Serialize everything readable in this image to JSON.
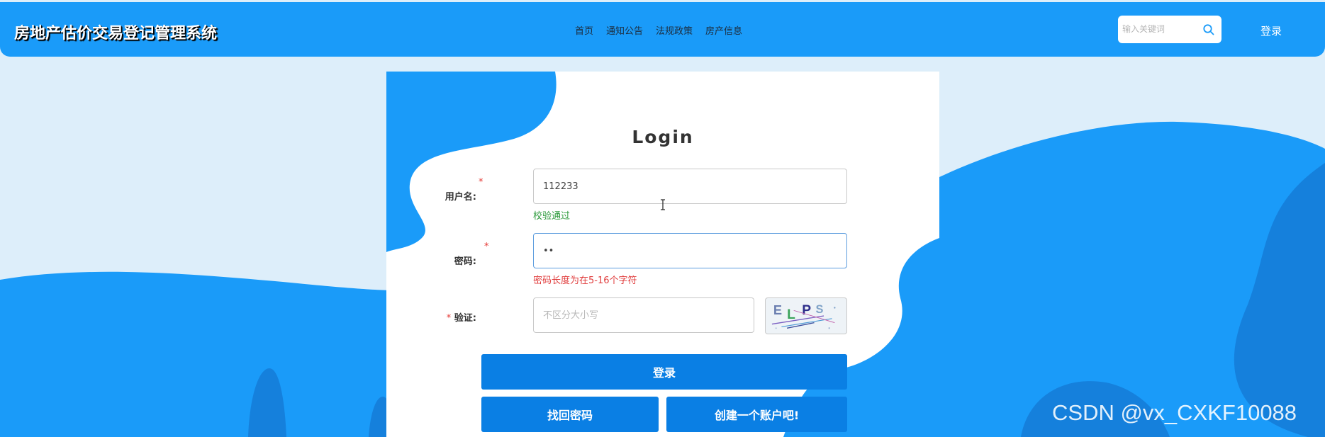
{
  "header": {
    "site_title": "房地产估价交易登记管理系统",
    "nav": [
      "首页",
      "通知公告",
      "法规政策",
      "房产信息"
    ],
    "search_placeholder": "输入关键词",
    "login_label": "登录"
  },
  "form": {
    "title": "Login",
    "username": {
      "label": "用户名:",
      "value": "112233",
      "hint": "校验通过"
    },
    "password": {
      "label": "密码:",
      "value": "11",
      "hint": "密码长度为在5-16个字符"
    },
    "captcha": {
      "label": "验证:",
      "placeholder": "不区分大小写",
      "code": "ELPS"
    },
    "required_mark": "*",
    "login_button": "登录",
    "forgot_button": "找回密码",
    "register_button": "创建一个账户吧!"
  },
  "watermark": "CSDN @vx_CXKF10088",
  "colors": {
    "header": "#1a9bf9",
    "accent": "#0a7fe4",
    "ok": "#2c9a3b",
    "error": "#e03c3c",
    "page_bg": "#ddeefa"
  },
  "icons": {
    "search": "search-icon",
    "captcha": "captcha-image"
  }
}
